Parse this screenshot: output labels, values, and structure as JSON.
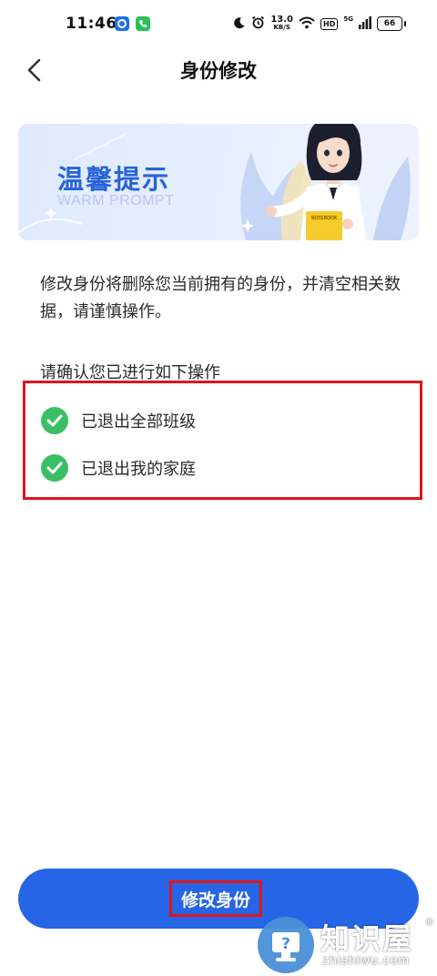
{
  "status_bar": {
    "time": "11:46",
    "net_speed_value": "13.0",
    "net_speed_unit": "KB/S",
    "hd_label": "HD",
    "network_label": "5G",
    "battery_level": "66",
    "icons": [
      "app-blue-icon",
      "app-green-phone-icon",
      "moon-icon",
      "alarm-icon",
      "wifi-icon",
      "signal-icon",
      "battery-icon"
    ]
  },
  "header": {
    "title": "身份修改",
    "back_icon": "chevron-left-icon"
  },
  "banner": {
    "title": "温馨提示",
    "subtitle": "WARM PROMPT",
    "notebook_label": "NOTEBOOK"
  },
  "content": {
    "notice": "修改身份将删除您当前拥有的身份，并清空相关数据，请谨慎操作。",
    "confirm_heading": "请确认您已进行如下操作",
    "checklist": [
      {
        "label": "已退出全部班级",
        "checked": true
      },
      {
        "label": "已退出我的家庭",
        "checked": true
      }
    ]
  },
  "footer": {
    "submit_label": "修改身份"
  },
  "watermark": {
    "brand": "知识屋",
    "domain": "zhishiwu.com",
    "registered": "®"
  },
  "colors": {
    "primary": "#2565e6",
    "check_green": "#3bbf66",
    "highlight_red": "#e0141c",
    "banner_title": "#2663d9"
  }
}
